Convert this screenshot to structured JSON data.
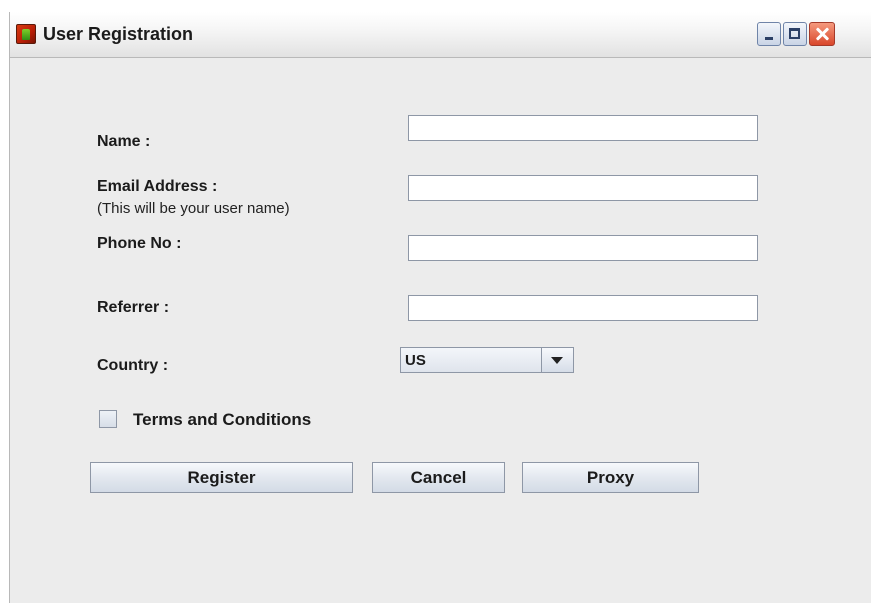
{
  "window": {
    "title": "User Registration"
  },
  "form": {
    "name": {
      "label": "Name :",
      "value": ""
    },
    "email": {
      "label": "Email Address :",
      "hint": "(This will be your user name)",
      "value": ""
    },
    "phone": {
      "label": "Phone No :",
      "value": ""
    },
    "referrer": {
      "label": "Referrer :",
      "value": ""
    },
    "country": {
      "label": "Country :",
      "selected": "US"
    },
    "terms": {
      "label": "Terms and Conditions",
      "checked": false
    }
  },
  "buttons": {
    "register": "Register",
    "cancel": "Cancel",
    "proxy": "Proxy"
  },
  "icons": {
    "app": "app-icon",
    "minimize": "minimize-icon",
    "maximize": "maximize-icon",
    "close": "close-icon",
    "dropdown": "chevron-down-icon"
  }
}
